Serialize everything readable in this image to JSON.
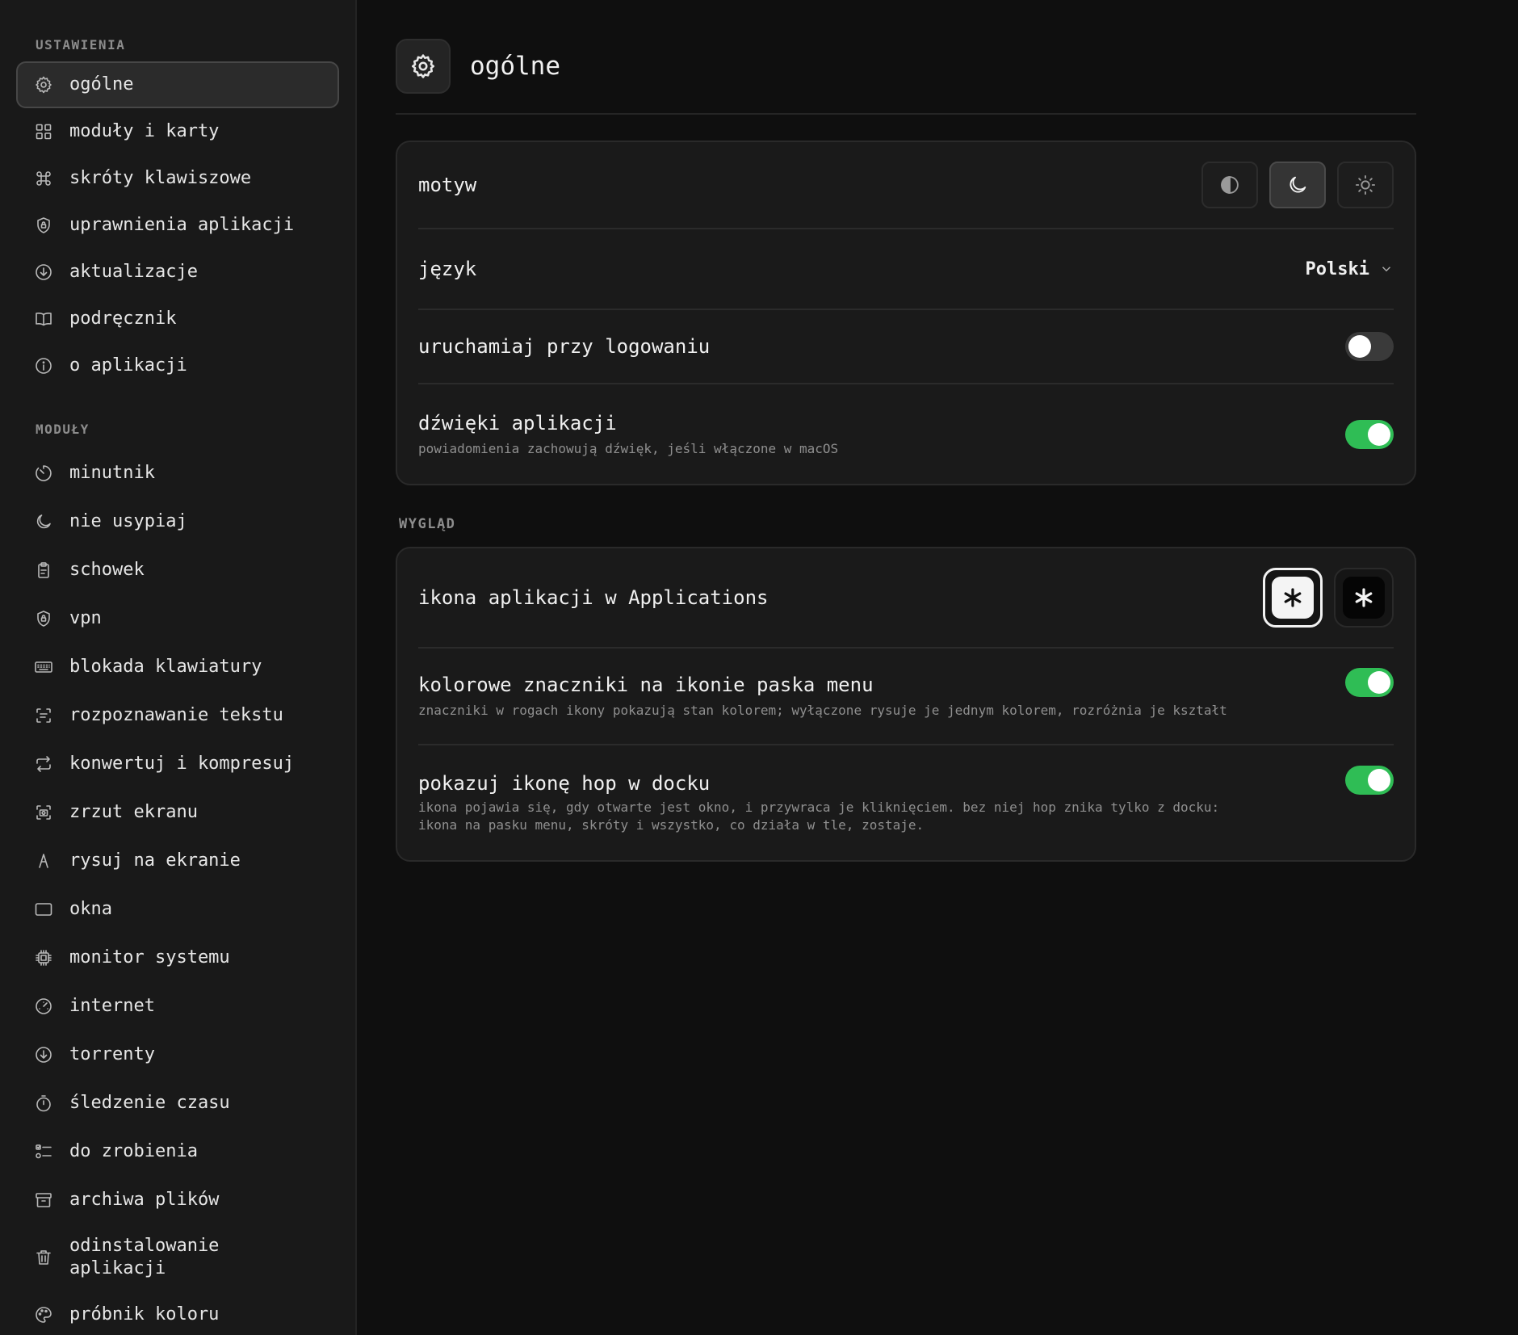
{
  "sidebar": {
    "section_settings": "USTAWIENIA",
    "settings_items": [
      {
        "label": "ogólne",
        "icon": "gear-icon",
        "active": true
      },
      {
        "label": "moduły i karty",
        "icon": "grid-icon"
      },
      {
        "label": "skróty klawiszowe",
        "icon": "command-icon"
      },
      {
        "label": "uprawnienia aplikacji",
        "icon": "shield-lock-icon"
      },
      {
        "label": "aktualizacje",
        "icon": "download-circle-icon"
      },
      {
        "label": "podręcznik",
        "icon": "book-icon"
      },
      {
        "label": "o aplikacji",
        "icon": "info-icon"
      }
    ],
    "section_modules": "MODUŁY",
    "module_items": [
      {
        "label": "minutnik",
        "icon": "timer-icon"
      },
      {
        "label": "nie usypiaj",
        "icon": "moon-icon"
      },
      {
        "label": "schowek",
        "icon": "clipboard-icon"
      },
      {
        "label": "vpn",
        "icon": "shield-lock-icon"
      },
      {
        "label": "blokada klawiatury",
        "icon": "keyboard-icon"
      },
      {
        "label": "rozpoznawanie tekstu",
        "icon": "text-scan-icon"
      },
      {
        "label": "konwertuj i kompresuj",
        "icon": "convert-icon"
      },
      {
        "label": "zrzut ekranu",
        "icon": "screenshot-icon"
      },
      {
        "label": "rysuj na ekranie",
        "icon": "draw-icon"
      },
      {
        "label": "okna",
        "icon": "window-icon"
      },
      {
        "label": "monitor systemu",
        "icon": "cpu-icon"
      },
      {
        "label": "internet",
        "icon": "speedometer-icon"
      },
      {
        "label": "torrenty",
        "icon": "download-circle-icon"
      },
      {
        "label": "śledzenie czasu",
        "icon": "stopwatch-icon"
      },
      {
        "label": "do zrobienia",
        "icon": "checklist-icon"
      },
      {
        "label": "archiwa plików",
        "icon": "archive-icon"
      },
      {
        "label": "odinstalowanie aplikacji",
        "icon": "trash-icon"
      },
      {
        "label": "próbnik koloru",
        "icon": "palette-icon"
      }
    ]
  },
  "header": {
    "title": "ogólne",
    "icon": "gear-icon"
  },
  "general": {
    "theme_label": "motyw",
    "theme_options": [
      "auto",
      "dark",
      "light"
    ],
    "theme_selected": "dark",
    "language_label": "język",
    "language_value": "Polski",
    "launch_label": "uruchamiaj przy logowaniu",
    "launch_on": false,
    "sounds_label": "dźwięki aplikacji",
    "sounds_desc": "powiadomienia zachowują dźwięk, jeśli włączone w macOS",
    "sounds_on": true
  },
  "appearance": {
    "heading": "WYGLĄD",
    "app_icon_label": "ikona aplikacji w Applications",
    "app_icon_selected": "light",
    "colored_label": "kolorowe znaczniki na ikonie paska menu",
    "colored_desc": "znaczniki w rogach ikony pokazują stan kolorem; wyłączone rysuje je jednym kolorem, rozróżnia je kształt",
    "colored_on": true,
    "dock_label": "pokazuj ikonę hop w docku",
    "dock_desc_1": "ikona pojawia się, gdy otwarte jest okno, i przywraca je kliknięciem. bez niej hop znika tylko z docku:",
    "dock_desc_2": "ikona na pasku menu, skróty i wszystko, co działa w tle, zostaje.",
    "dock_on": true
  },
  "colors": {
    "accent_green": "#2fbd55",
    "background": "#0f0f0f",
    "sidebar": "#191919"
  }
}
